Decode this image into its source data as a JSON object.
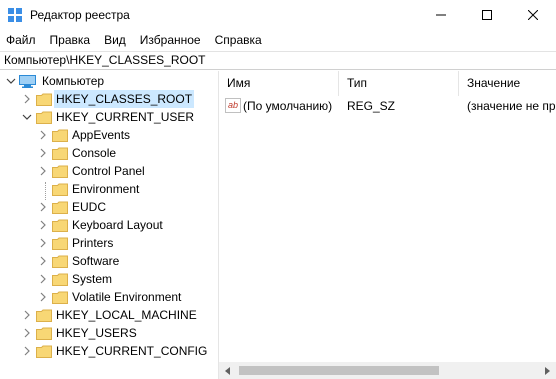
{
  "window": {
    "title": "Редактор реестра",
    "app_icon": "registry-editor-icon"
  },
  "controls": {
    "minimize": "minimize-icon",
    "maximize": "maximize-icon",
    "close": "close-icon"
  },
  "menu": [
    "Файл",
    "Правка",
    "Вид",
    "Избранное",
    "Справка"
  ],
  "address": "Компьютер\\HKEY_CLASSES_ROOT",
  "tree": {
    "root": "Компьютер",
    "hives": [
      {
        "label": "HKEY_CLASSES_ROOT",
        "selected": true
      },
      {
        "label": "HKEY_CURRENT_USER",
        "expanded": true,
        "children": [
          {
            "label": "AppEvents",
            "has_children": true
          },
          {
            "label": "Console",
            "has_children": true
          },
          {
            "label": "Control Panel",
            "has_children": true
          },
          {
            "label": "Environment",
            "has_children": false
          },
          {
            "label": "EUDC",
            "has_children": true
          },
          {
            "label": "Keyboard Layout",
            "has_children": true
          },
          {
            "label": "Printers",
            "has_children": true
          },
          {
            "label": "Software",
            "has_children": true
          },
          {
            "label": "System",
            "has_children": true
          },
          {
            "label": "Volatile Environment",
            "has_children": true
          }
        ]
      },
      {
        "label": "HKEY_LOCAL_MACHINE"
      },
      {
        "label": "HKEY_USERS"
      },
      {
        "label": "HKEY_CURRENT_CONFIG"
      }
    ]
  },
  "list": {
    "columns": [
      "Имя",
      "Тип",
      "Значение"
    ],
    "rows": [
      {
        "icon": "string-value-icon",
        "icon_text": "ab",
        "name": "(По умолчанию)",
        "type": "REG_SZ",
        "value": "(значение не пр"
      }
    ]
  },
  "colors": {
    "selection": "#cce8ff",
    "folder": "#f8d775",
    "folder_edge": "#dcb04a",
    "computer_icon": "#2b8ad6"
  }
}
